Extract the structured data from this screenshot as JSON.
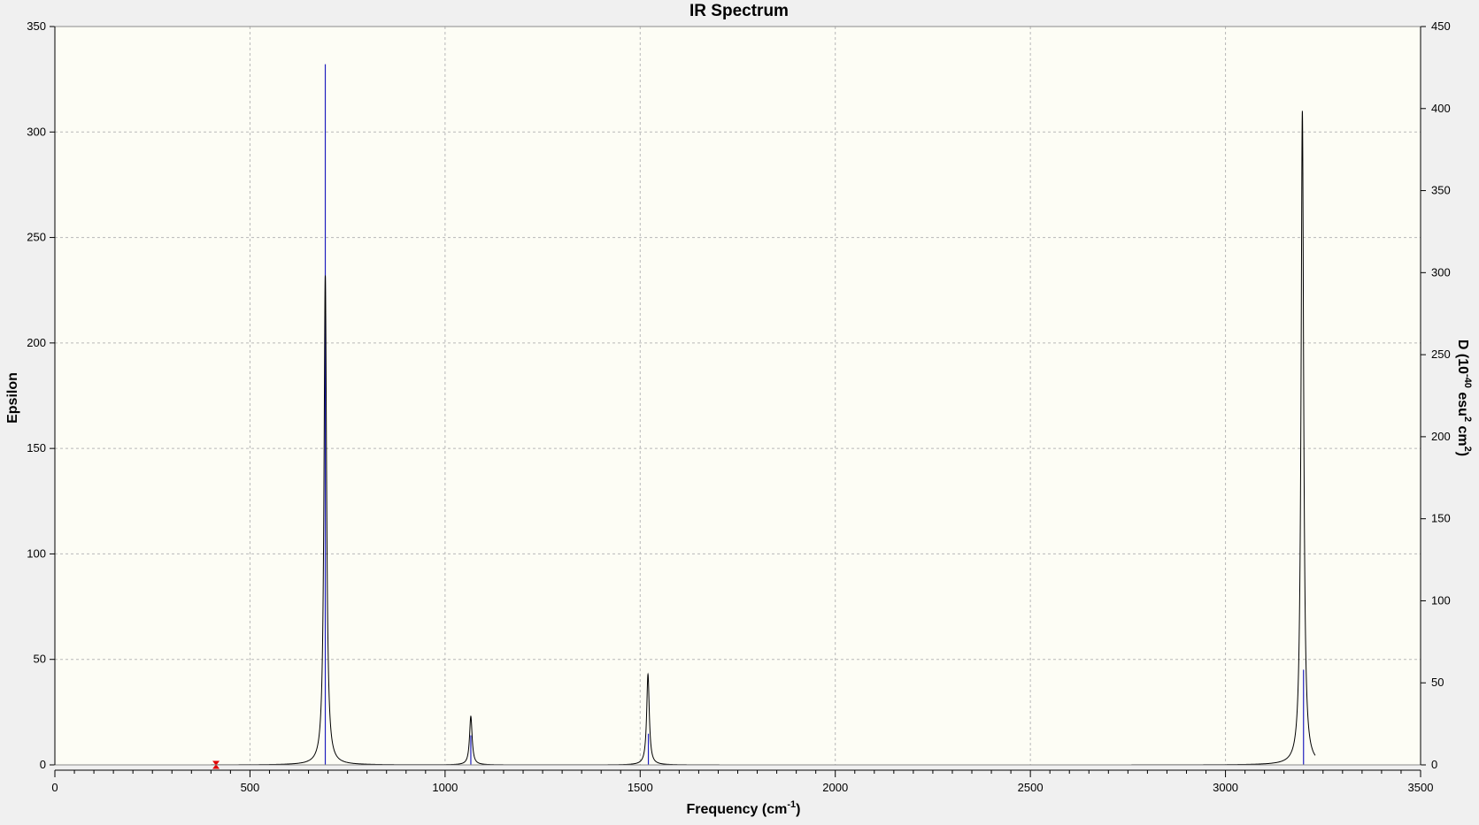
{
  "chart_data": {
    "type": "line",
    "title": "IR Spectrum",
    "xlabel": {
      "main": "Frequency (cm",
      "sup": "-1",
      "tail": ")"
    },
    "ylabel_left": "Epsilon",
    "ylabel_right": {
      "pre": "D (10",
      "sup1": "-40",
      "mid": " esu",
      "sup2": "2",
      "mid2": " cm",
      "sup3": "2",
      "tail": ")"
    },
    "xlim": [
      0,
      3500
    ],
    "ylim_left": [
      0,
      350
    ],
    "ylim_right": [
      0,
      450
    ],
    "x_ticks": [
      0,
      500,
      1000,
      1500,
      2000,
      2500,
      3000,
      3500
    ],
    "y_left_ticks": [
      0,
      50,
      100,
      150,
      200,
      250,
      300,
      350
    ],
    "y_right_ticks": [
      0,
      50,
      100,
      150,
      200,
      250,
      300,
      350,
      400,
      450
    ],
    "grid": true,
    "colors": {
      "plot_bg": "#fdfdf5",
      "spectrum": "#000000",
      "sticks": "#1f1fbf",
      "marker": "#e00000"
    },
    "spectrum_range": [
      400,
      3230
    ],
    "peaks": [
      {
        "freq": 693,
        "epsilon": 232,
        "hwhm": 4
      },
      {
        "freq": 1066,
        "epsilon": 23,
        "hwhm": 4
      },
      {
        "freq": 1520,
        "epsilon": 43,
        "hwhm": 4
      },
      {
        "freq": 3197,
        "epsilon": 310,
        "hwhm": 4
      }
    ],
    "sticks": [
      {
        "freq": 693,
        "D": 427
      },
      {
        "freq": 1066,
        "D": 18
      },
      {
        "freq": 1521,
        "D": 19
      },
      {
        "freq": 3200,
        "D": 58
      }
    ],
    "marker": {
      "freq": 413,
      "epsilon": 0
    }
  }
}
